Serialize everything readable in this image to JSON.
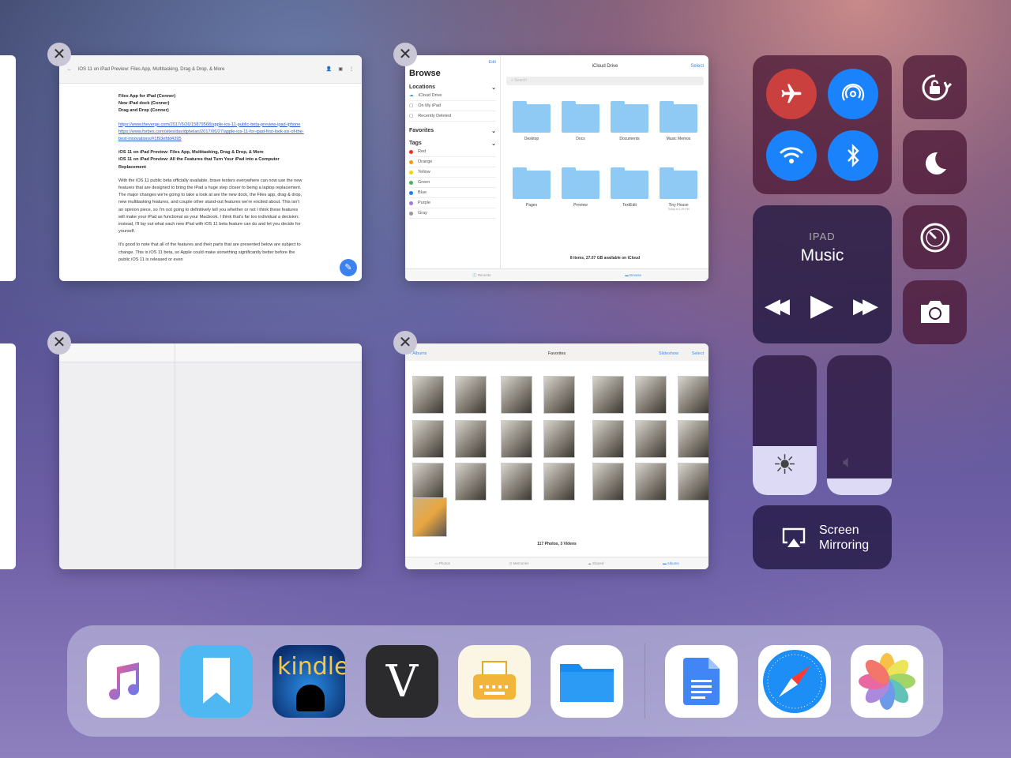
{
  "doc_card": {
    "title": "iOS 11 on iPad Preview: Files App, Multitasking, Drag & Drop, & More",
    "outline": [
      "Files App for iPad (Conner)",
      "New iPad dock (Conner)",
      "Drag and Drop (Conner)"
    ],
    "links": [
      "https://www.theverge.com/2017/6/26/15879568/apple-ios-11-public-beta-preview-ipad-iphone",
      "https://www.forbes.com/sites/davidphelan/2017/06/27/apple-ios-11-for-ipad-first-look-six-of-the-best-innovations/#1f93efdd4395"
    ],
    "headlines": [
      "iOS 11 on iPad Preview: Files App, Multitasking, Drag & Drop, & More",
      "iOS 11 on iPad Preview: All the Features that Turn Your iPad into a Computer Replacement"
    ],
    "para1": "With the iOS 11 public beta officially available, brave testers everywhere can now use the new features that are designed to bring the iPad a huge step closer to being a laptop replacement. The major changes we're going to take a look at are the new dock, the Files app, drag & drop, new multitasking features, and couple other stand-out features we're excited about. This isn't an opinion piece, so I'm not going to definitively tell you whether or not I think these features will make your iPad as functional as your Macbook. I think that's far too individual a decision; instead, I'll lay out what each new iPad with iOS 11 beta feature can do and let you decide for yourself.",
    "para2": "It's good to note that all of the features and their parts that are presented below are subject to change. This is iOS 11 beta, so Apple could make something significantly better before the public iOS 11 is released or even"
  },
  "files_card": {
    "edit": "Edit",
    "browse": "Browse",
    "header": "iCloud Drive",
    "select": "Select",
    "search_placeholder": "Search",
    "locations_label": "Locations",
    "locations": [
      "iCloud Drive",
      "On My iPad",
      "Recently Deleted"
    ],
    "favorites_label": "Favorites",
    "tags_label": "Tags",
    "tags": [
      {
        "name": "Red",
        "color": "#e8352c"
      },
      {
        "name": "Orange",
        "color": "#f59a0c"
      },
      {
        "name": "Yellow",
        "color": "#f4d20d"
      },
      {
        "name": "Green",
        "color": "#45b35e"
      },
      {
        "name": "Blue",
        "color": "#1f7ef2"
      },
      {
        "name": "Purple",
        "color": "#a07ad8"
      },
      {
        "name": "Gray",
        "color": "#999999"
      }
    ],
    "folders": [
      {
        "name": "Desktop"
      },
      {
        "name": "Docs"
      },
      {
        "name": "Documents"
      },
      {
        "name": "Music Memos"
      },
      {
        "name": "Pages"
      },
      {
        "name": "Preview"
      },
      {
        "name": "TextEdit"
      },
      {
        "name": "Tiny House",
        "sub": "Today at 1:05 PM"
      }
    ],
    "footer": "8 items, 27.07 GB available on iCloud",
    "tabs": [
      "Recents",
      "Browse"
    ]
  },
  "photos_card": {
    "back": "Albums",
    "title": "Favorites",
    "slideshow": "Slideshow",
    "select": "Select",
    "footer": "117 Photos, 3 Videos",
    "tabs": [
      "Photos",
      "Memories",
      "Shared",
      "Albums"
    ]
  },
  "control_center": {
    "music_source": "IPAD",
    "music_title": "Music",
    "screen_mirroring": "Screen Mirroring",
    "brightness": 0.35,
    "volume": 0.12,
    "colors": {
      "airplane": "#d8443f",
      "blue": "#1a82fb"
    }
  },
  "dock": {
    "apps": [
      "Music",
      "Bookmarks",
      "Kindle",
      "Vesper",
      "Typewriter",
      "Files",
      "Google Docs",
      "Safari",
      "Photos"
    ],
    "kindle_text": "kindle",
    "vesper_text": "V"
  }
}
